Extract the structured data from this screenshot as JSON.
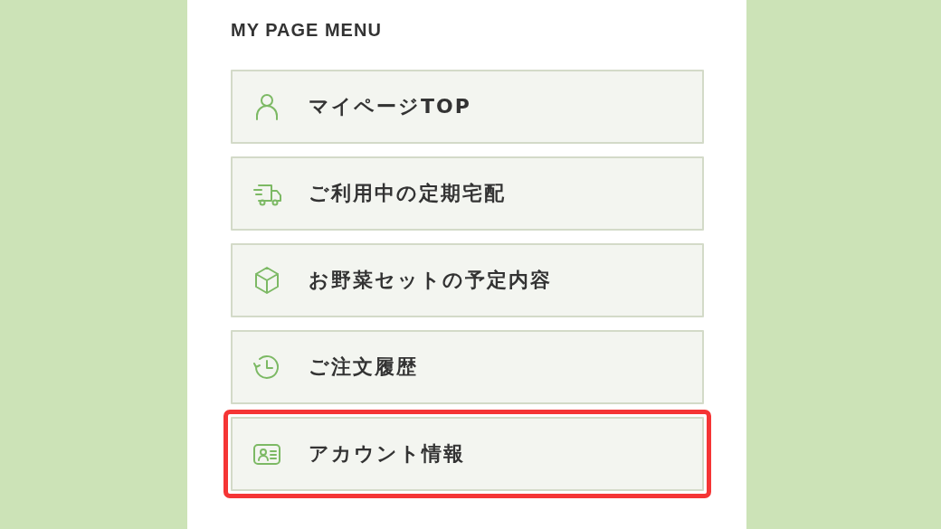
{
  "menu": {
    "title": "MY PAGE MENU",
    "items": [
      {
        "label": "マイページTOP",
        "highlighted": false
      },
      {
        "label": "ご利用中の定期宅配",
        "highlighted": false
      },
      {
        "label": "お野菜セットの予定内容",
        "highlighted": false
      },
      {
        "label": "ご注文履歴",
        "highlighted": false
      },
      {
        "label": "アカウント情報",
        "highlighted": true
      }
    ]
  }
}
